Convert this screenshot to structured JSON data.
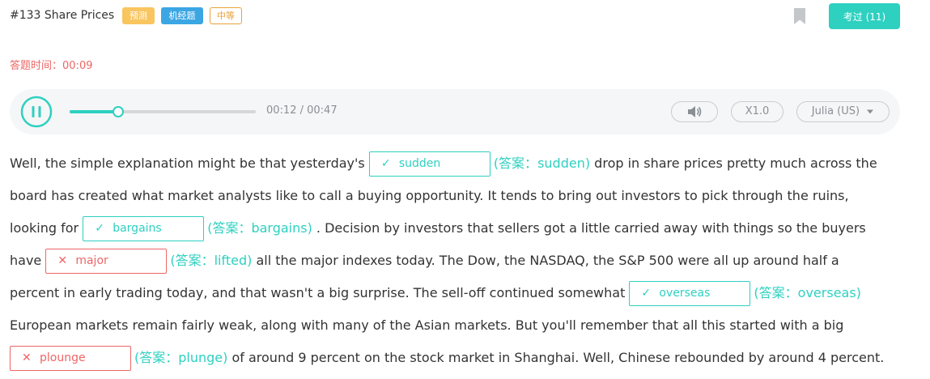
{
  "header": {
    "title": "#133 Share Prices",
    "tags": [
      "预测",
      "机经题",
      "中等"
    ],
    "exam_button": "考过 (11)"
  },
  "timer": {
    "label": "答题时间：",
    "value": "00:09"
  },
  "player": {
    "current_time": "00:12",
    "total_time": "00:47",
    "progress_fraction": 0.255,
    "speed": "X1.0",
    "voice": "Julia (US)"
  },
  "passage": {
    "answer_prefix": "(答案：",
    "answer_suffix": ")",
    "segments": [
      "Well, the simple explanation might be that yesterday's ",
      " drop in share prices pretty much across the board has created what market analysts like to call a buying opportunity. It tends to bring out investors to pick through the ruins, looking for ",
      " . Decision by investors that sellers got a little carried away with things so the buyers have ",
      " all the major indexes today. The Dow, the NASDAQ, the S&P 500 were all up around half a percent in early trading today, and that wasn't a big surprise. The sell-off continued somewhat ",
      " European markets remain fairly weak, along with many of the Asian markets. But you'll remember that all this started with a big ",
      " of around 9 percent on the stock market in Shanghai. Well, Chinese rebounded by around 4 percent."
    ],
    "blanks": [
      {
        "input": "sudden",
        "answer": "sudden",
        "correct": true
      },
      {
        "input": "bargains",
        "answer": "bargains",
        "correct": true
      },
      {
        "input": "major",
        "answer": "lifted",
        "correct": false
      },
      {
        "input": "overseas",
        "answer": "overseas",
        "correct": true
      },
      {
        "input": "plounge",
        "answer": "plunge",
        "correct": false
      }
    ]
  },
  "colors": {
    "accent": "#2ed0c0",
    "error": "#ee6666",
    "tag_yellow": "#f8c55f",
    "tag_blue": "#3ba6e3",
    "tag_orange": "#e8a23a"
  },
  "icons": {
    "bookmark": "bookmark-icon",
    "pause": "pause-icon",
    "volume": "volume-icon",
    "dropdown": "caret-down-icon",
    "correct": "check-icon",
    "wrong": "cross-icon"
  }
}
